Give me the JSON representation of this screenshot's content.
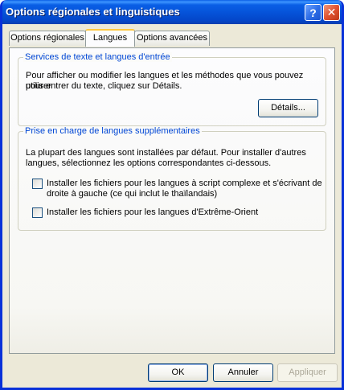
{
  "window": {
    "title": "Options régionales et linguistiques"
  },
  "titlebar": {
    "help_glyph": "?",
    "close_glyph": "✕"
  },
  "tabs": [
    {
      "label": "Options régionales",
      "active": false
    },
    {
      "label": "Langues",
      "active": true
    },
    {
      "label": "Options avancées",
      "active": false
    }
  ],
  "text_services": {
    "title": "Services de texte et langues d'entrée",
    "description_line1": "Pour afficher ou modifier les langues et les méthodes que vous pouvez utiliser",
    "description_line2": "pour entrer du texte, cliquez sur Détails.",
    "details_button": "Détails..."
  },
  "supplemental_languages": {
    "title": "Prise en charge de langues supplémentaires",
    "description_line1": "La plupart des langues sont installées par défaut. Pour installer d'autres",
    "description_line2": "langues, sélectionnez les options correspondantes ci-dessous.",
    "options": [
      {
        "line1": "Installer les fichiers pour les langues à script complexe et s'écrivant de",
        "line2": "droite à gauche (ce qui inclut le thaïlandais)",
        "checked": false
      },
      {
        "line1": "Installer les fichiers pour les langues d'Extrême-Orient",
        "checked": false
      }
    ]
  },
  "footer": {
    "ok": "OK",
    "cancel": "Annuler",
    "apply": "Appliquer"
  },
  "colors": {
    "titlebar": "#0552d8",
    "group_title": "#0046d5",
    "dialog_bg": "#ece9d8",
    "active_tab_accent": "#ffc83c"
  }
}
